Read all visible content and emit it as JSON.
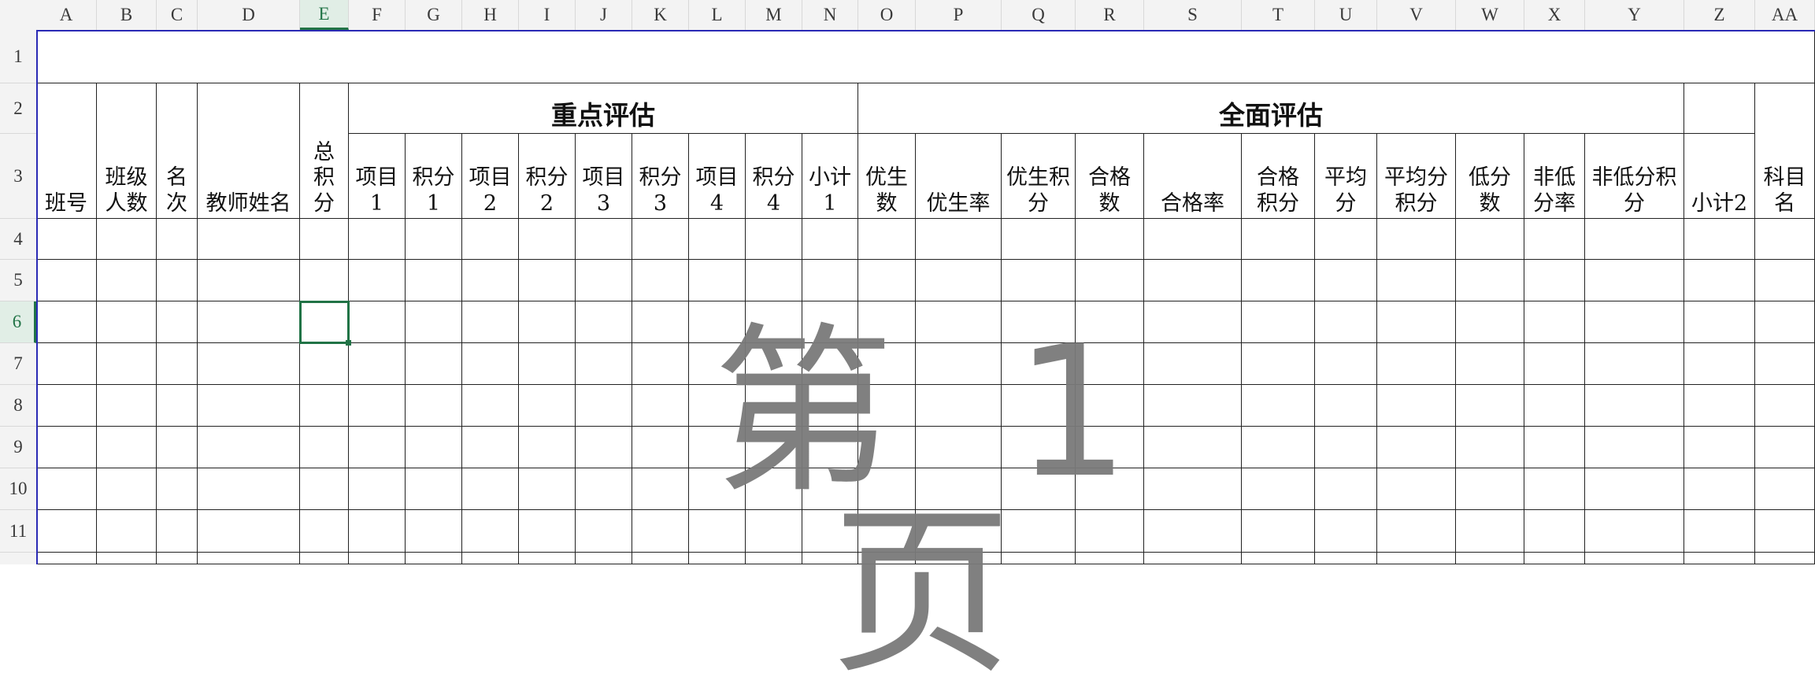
{
  "columns": [
    "A",
    "B",
    "C",
    "D",
    "E",
    "F",
    "G",
    "H",
    "I",
    "J",
    "K",
    "L",
    "M",
    "N",
    "O",
    "P",
    "Q",
    "R",
    "S",
    "T",
    "U",
    "V",
    "W",
    "X",
    "Y",
    "Z",
    "AA"
  ],
  "rows": [
    "1",
    "2",
    "3",
    "4",
    "5",
    "6",
    "7",
    "8",
    "9",
    "10",
    "11"
  ],
  "active_cell": {
    "column": "E",
    "row": "6"
  },
  "group_headers": {
    "key_eval": "重点评估",
    "full_eval": "全面评估"
  },
  "field_headers": {
    "class_no": "班号",
    "class_size": "班级人数",
    "rank": "名次",
    "teacher_name": "教师姓名",
    "total_points": "总积分",
    "item1": "项目1",
    "points1": "积分1",
    "item2": "项目2",
    "points2": "积分2",
    "item3": "项目3",
    "points3": "积分3",
    "item4": "项目4",
    "points4": "积分4",
    "subtotal1": "小计1",
    "excellent_count": "优生数",
    "excellent_rate": "优生率",
    "excellent_points": "优生积分",
    "pass_count": "合格数",
    "pass_rate": "合格率",
    "pass_points": "合格积分",
    "average": "平均分",
    "average_points": "平均分积分",
    "low_count": "低分数",
    "non_low_rate": "非低分率",
    "non_low_points": "非低分积分",
    "subtotal2": "小计2",
    "subject_name": "科目名"
  },
  "watermark": "第 1 页"
}
